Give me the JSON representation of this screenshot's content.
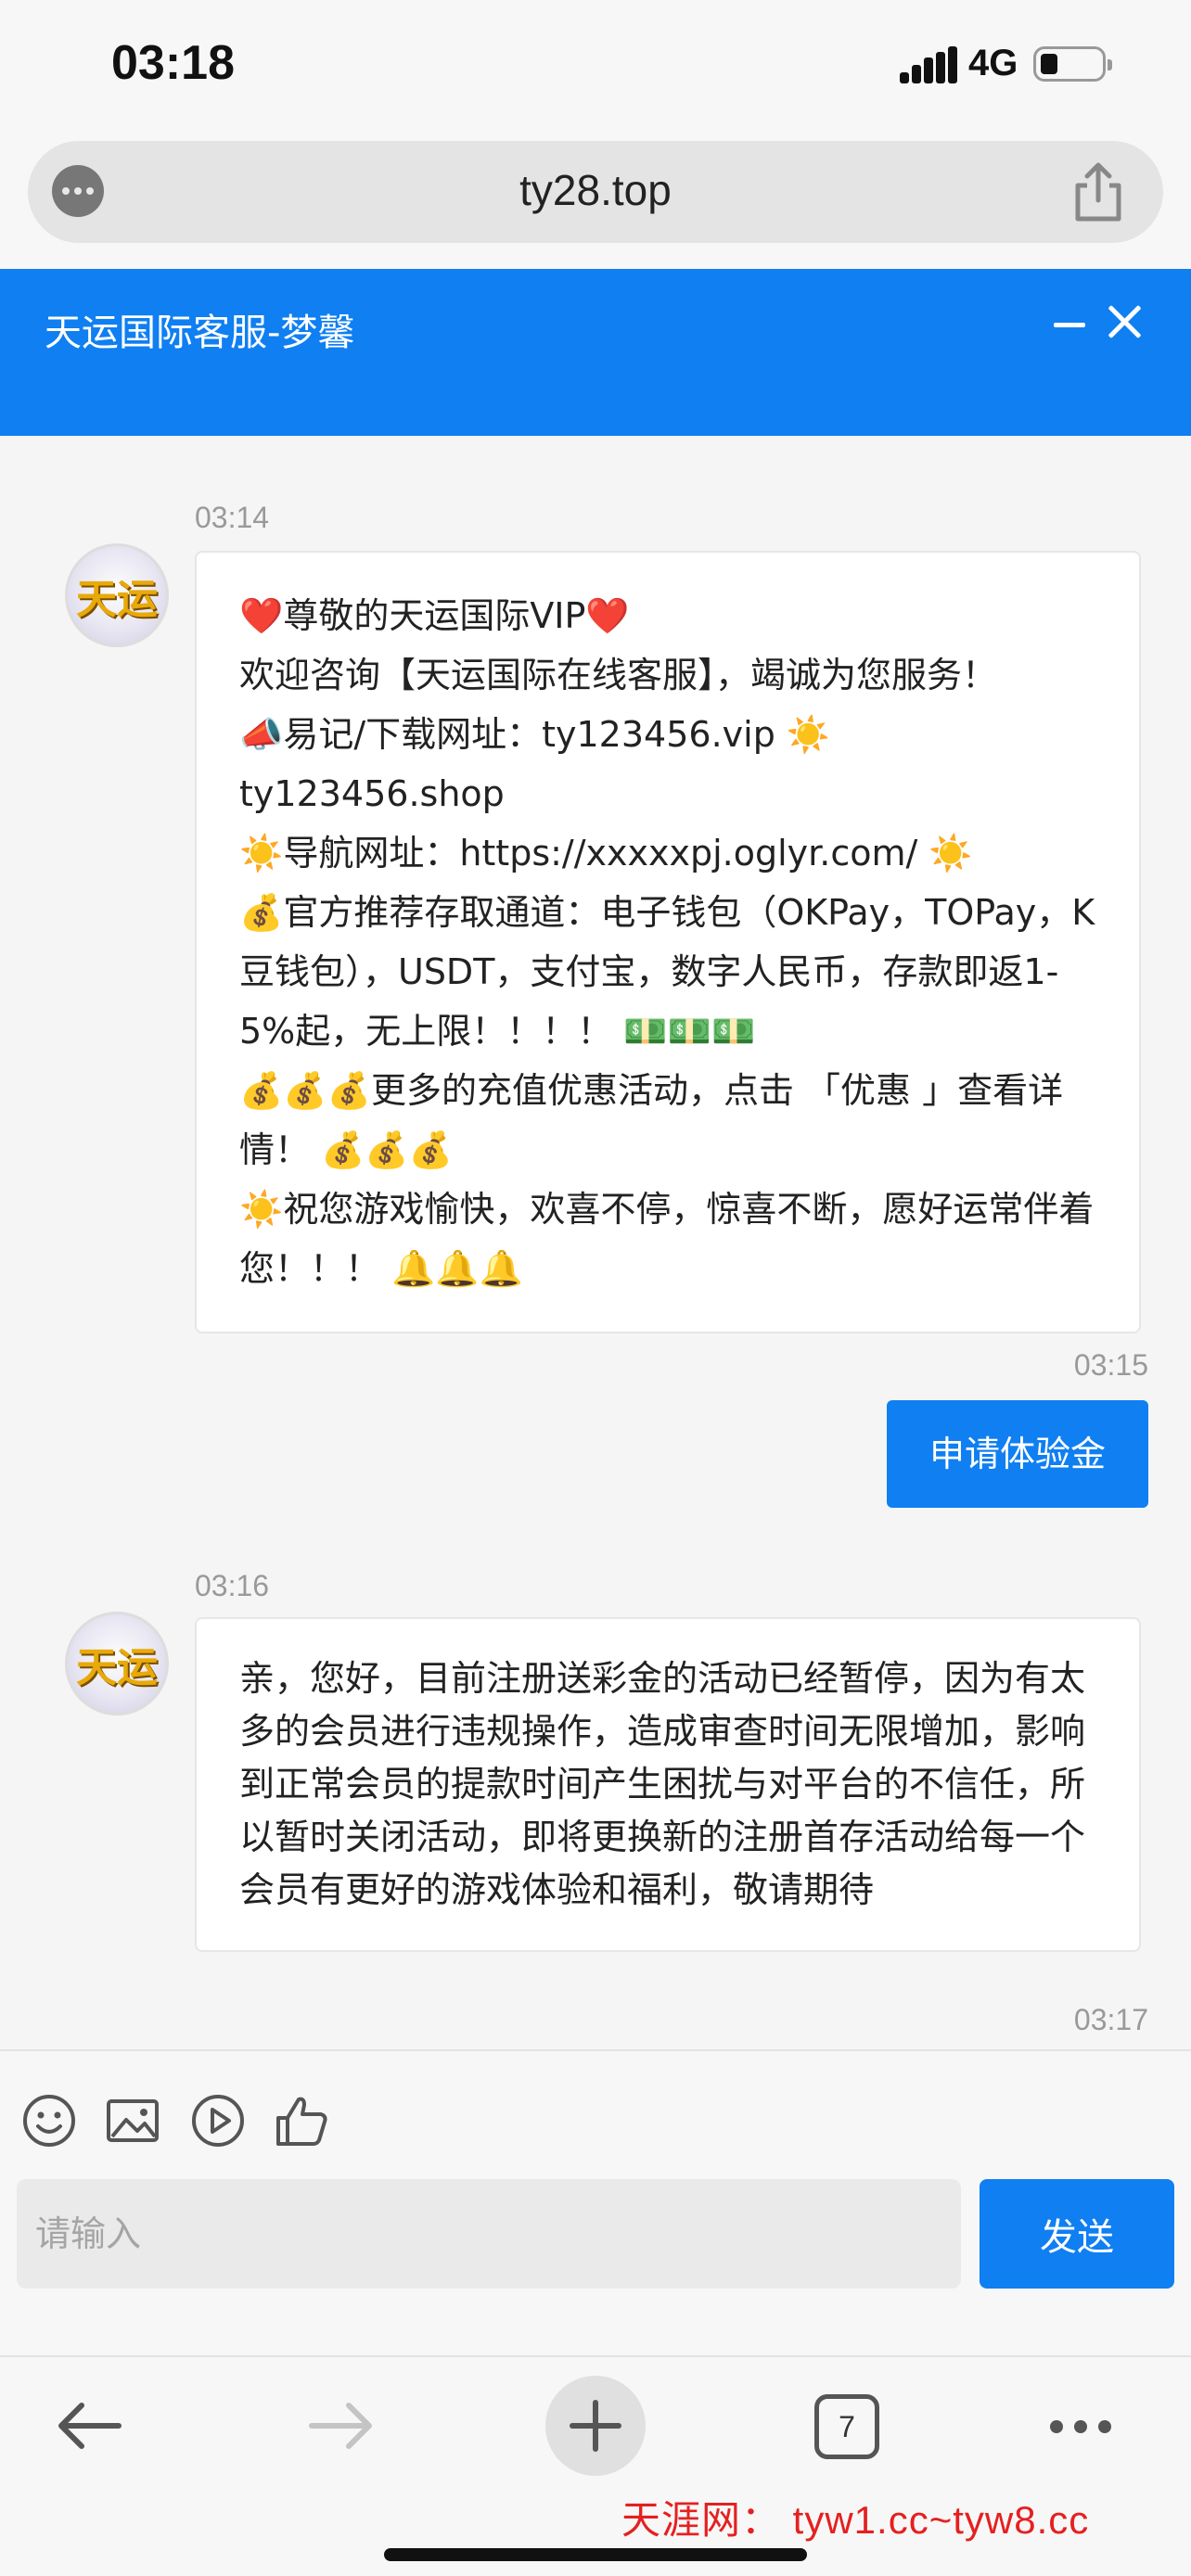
{
  "status_bar": {
    "time": "03:18",
    "network": "4G"
  },
  "browser": {
    "url": "ty28.top"
  },
  "chat_header": {
    "title": "天运国际客服-梦馨"
  },
  "messages": [
    {
      "time": "03:14",
      "sender": "agent",
      "lines": [
        "❤️尊敬的天运国际VIP❤️",
        "欢迎咨询【天运国际在线客服】，竭诚为您服务！",
        "📣易记/下载网址：ty123456.vip ☀️ ty123456.shop",
        "☀️导航网址：https://xxxxxpj.oglyr.com/ ☀️",
        "💰官方推荐存取通道：电子钱包（OKPay，TOPay，K豆钱包），USDT，支付宝，数字人民币，存款即返1-5%起，无上限！！！！ 💵💵💵",
        "💰💰💰更多的充值优惠活动，点击 「优惠 」查看详情！ 💰💰💰",
        "☀️祝您游戏愉快，欢喜不停，惊喜不断，愿好运常伴着您！！！ 🔔🔔🔔"
      ]
    },
    {
      "time": "03:15",
      "sender": "user",
      "text": "申请体验金"
    },
    {
      "time": "03:16",
      "sender": "agent",
      "text": "亲，您好，目前注册送彩金的活动已经暂停，因为有太多的会员进行违规操作，造成审查时间无限增加，影响到正常会员的提款时间产生困扰与对平台的不信任，所以暂时关闭活动，即将更换新的注册首存活动给每一个会员有更好的游戏体验和福利，敬请期待"
    },
    {
      "time": "03:17",
      "sender": "user",
      "text": ""
    }
  ],
  "avatar": {
    "logo_text": "天运"
  },
  "composer": {
    "placeholder": "请输入",
    "send_label": "发送"
  },
  "bottom_nav": {
    "tab_count": "7"
  },
  "watermark": "天涯网： tyw1.cc~tyw8.cc",
  "colors": {
    "accent": "#0f7ff2",
    "background": "#f5f5f5"
  }
}
